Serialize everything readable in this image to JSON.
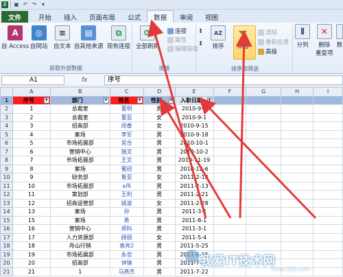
{
  "qat": {
    "undo_label": "↶",
    "redo_label": "↷"
  },
  "tabs": [
    {
      "label": "文件"
    },
    {
      "label": "开始"
    },
    {
      "label": "插入"
    },
    {
      "label": "页面布局"
    },
    {
      "label": "公式"
    },
    {
      "label": "数据"
    },
    {
      "label": "审阅"
    },
    {
      "label": "视图"
    }
  ],
  "ribbon": {
    "access": "自 Access",
    "web": "自网站",
    "text": "自文本",
    "other": "自其他来源",
    "existing": "现有连接",
    "external_group": "获取外部数据",
    "refresh_all": "全部刷新",
    "connections": "连接",
    "properties": "属性",
    "edit_links": "编辑链接",
    "connections_group": "连接",
    "sort": "排序",
    "filter": "筛选",
    "clear": "清除",
    "reapply": "重新应用",
    "advanced": "高级",
    "sort_filter_group": "排序和筛选",
    "split": "分列",
    "remove_dup": "删除",
    "remove_dup2": "重复项",
    "data_valid": "数"
  },
  "formula_bar": {
    "name_box": "A1",
    "fx": "fx",
    "formula": "序号"
  },
  "columns": [
    "A",
    "B",
    "C",
    "D",
    "E",
    "F",
    "G",
    "H",
    "I"
  ],
  "headers": [
    "序号",
    "部门",
    "姓名",
    "性别",
    "入职日期"
  ],
  "rows": [
    [
      "1",
      "总裁室",
      "董明",
      "男",
      "2010-9-1"
    ],
    [
      "2",
      "总裁室",
      "董亚",
      "女",
      "2010-9-1"
    ],
    [
      "3",
      "招商部",
      "闵香",
      "女",
      "2010-9-15"
    ],
    [
      "4",
      "案场",
      "李军",
      "男",
      "2010-9-18"
    ],
    [
      "5",
      "市场拓展部",
      "吴合",
      "男",
      "2010-10-1"
    ],
    [
      "6",
      "营销中心",
      "施文",
      "男",
      "2010-10-2"
    ],
    [
      "7",
      "市场拓展部",
      "王文",
      "男",
      "2010-11-19"
    ],
    [
      "8",
      "案场",
      "蜜绍",
      "男",
      "2010-12-6"
    ],
    [
      "9",
      "财务部",
      "鲁亚",
      "女",
      "2011-2-12"
    ],
    [
      "10",
      "市场拓展部",
      "a伟",
      "男",
      "2011-2-13"
    ],
    [
      "11",
      "策划部",
      "王利",
      "男",
      "2011-2-21"
    ],
    [
      "12",
      "招商运营部",
      "姚波",
      "女",
      "2011-2-28"
    ],
    [
      "13",
      "案场",
      "孙",
      "男",
      "2011-3-1"
    ],
    [
      "15",
      "案场",
      "勇",
      "男",
      "2011-8-1"
    ],
    [
      "16",
      "营销中心",
      "郑科",
      "男",
      "2011-3-1"
    ],
    [
      "17",
      "人力资源部",
      "顾丽",
      "女",
      "2011-5-4"
    ],
    [
      "18",
      "舟山行销",
      "袁亮2",
      "男",
      "2011-5-25"
    ],
    [
      "19",
      "市场拓展部",
      "永忠",
      "男",
      "2011-6-15"
    ],
    [
      "20",
      "招商部",
      "钟锋",
      "男",
      "2011-7-11"
    ],
    [
      "21",
      "1",
      "马燕杰",
      "男",
      "2011-7-22"
    ]
  ],
  "watermark": {
    "text": "我爱IT技术网",
    "url": "www.52ij.com"
  },
  "colors": {
    "arrow": "#e23a3a",
    "file_tab": "#2a6a2e",
    "header_red": "#ff1c1c",
    "header_blue": "#9fb8e0"
  }
}
